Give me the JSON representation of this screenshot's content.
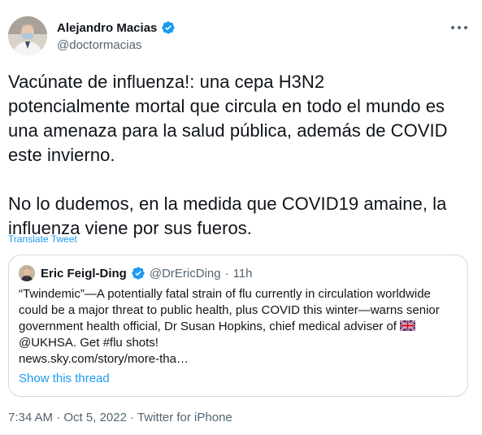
{
  "author": {
    "name": "Alejandro Macias",
    "handle": "@doctormacias",
    "avatar_icon": "person-avatar",
    "verified_color": "#1d9bf0"
  },
  "tweet": {
    "text": "Vacúnate de influenza!: una cepa H3N2\npotencialmente mortal que circula en todo el mundo es\nuna amenaza para la salud pública, además de COVID\neste invierno.\n\nNo lo dudemos, en la medida que COVID19 amaine, la\ninfluenza viene por sus fueros.",
    "translate_label": "Translate Tweet"
  },
  "quote": {
    "name": "Eric Feigl-Ding",
    "handle": "@DrEricDing",
    "separator": "·",
    "time": "11h",
    "lines": [
      "“Twindemic”—A potentially fatal strain of flu currently in circulation worldwide",
      "could be a major threat to public health, plus COVID this winter—warns senior",
      "government health official, Dr Susan Hopkins, chief medical adviser of",
      "@UKHSA. Get #flu shots!",
      "news.sky.com/story/more-tha…"
    ],
    "flag_icon": "uk-flag-icon",
    "show_thread_label": "Show this thread"
  },
  "footer": {
    "time": "7:34 AM",
    "sep1": "·",
    "date": "Oct 5, 2022",
    "sep2": "·",
    "source": "Twitter for iPhone"
  },
  "colors": {
    "accent": "#1d9bf0",
    "text": "#0f1419",
    "secondary": "#536471",
    "border": "#cfd9de"
  }
}
